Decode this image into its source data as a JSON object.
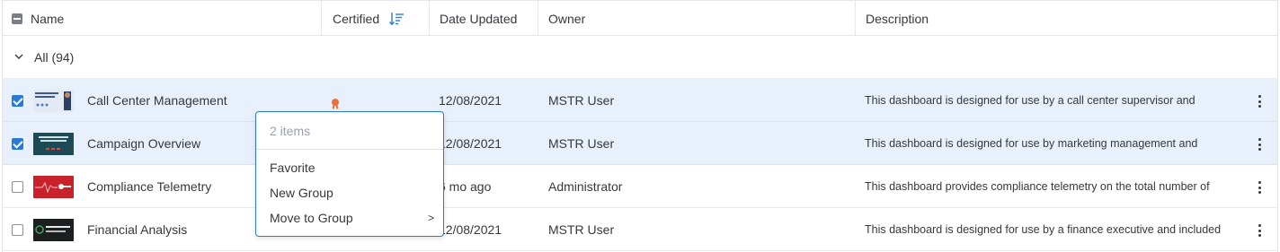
{
  "columns": {
    "name": "Name",
    "certified": "Certified",
    "date_updated": "Date Updated",
    "owner": "Owner",
    "description": "Description"
  },
  "sort_state": {
    "column": "Certified",
    "icon": "sort-descending-icon",
    "color": "#2d7ad6"
  },
  "group": {
    "label": "All (94)",
    "expanded": true
  },
  "rows": [
    {
      "name": "Call Center Management",
      "selected": true,
      "certified": true,
      "date": "12/08/2021",
      "owner": "MSTR User",
      "description": "This dashboard is designed for use by a call center supervisor and",
      "thumb_color": "#dfe6f1"
    },
    {
      "name": "Campaign Overview",
      "selected": true,
      "certified": false,
      "date": "12/08/2021",
      "owner": "MSTR User",
      "description": "This dashboard is designed for use by marketing management and",
      "thumb_color": "#1e4a56"
    },
    {
      "name": "Compliance Telemetry",
      "selected": false,
      "certified": false,
      "date": "6 mo ago",
      "owner": "Administrator",
      "description": "This dashboard provides compliance telemetry on the total number of",
      "thumb_color": "#d0262d"
    },
    {
      "name": "Financial Analysis",
      "selected": false,
      "certified": false,
      "date": "12/08/2021",
      "owner": "MSTR User",
      "description": "This dashboard is designed for use by a finance executive and included",
      "thumb_color": "#1b1f1f"
    }
  ],
  "context_menu": {
    "header": "2 items",
    "items": [
      {
        "label": "Favorite"
      },
      {
        "label": "New Group"
      },
      {
        "label": "Move to Group",
        "submenu_arrow": ">"
      }
    ]
  },
  "colors": {
    "accent": "#2d7ad6",
    "selected_row": "#e8f1fb",
    "certified_badge": "#e8703a"
  }
}
